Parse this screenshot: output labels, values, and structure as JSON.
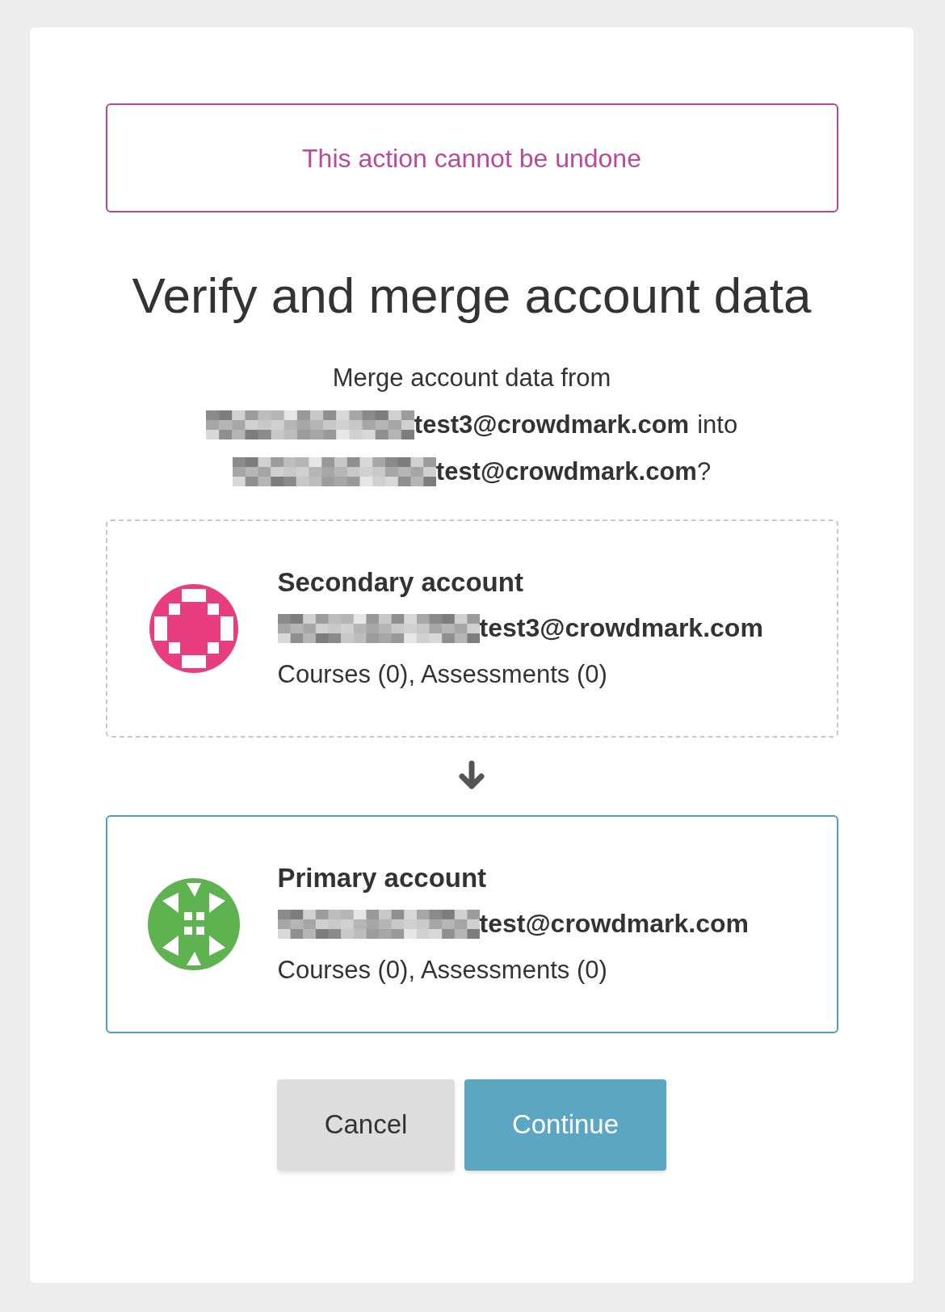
{
  "warning": "This action cannot be undone",
  "title": "Verify and merge account data",
  "message": {
    "intro": "Merge account data from",
    "from_email": "test3@crowdmark.com",
    "connector": "into",
    "to_email": "test@crowdmark.com",
    "end": "?"
  },
  "accounts": [
    {
      "kind": "secondary",
      "label": "Secondary account",
      "email": "test3@crowdmark.com",
      "summary": "Courses (0), Assessments (0)"
    },
    {
      "kind": "primary",
      "label": "Primary account",
      "email": "test@crowdmark.com",
      "summary": "Courses (0), Assessments (0)"
    }
  ],
  "buttons": [
    {
      "kind": "cancel",
      "label": "Cancel"
    },
    {
      "kind": "continue",
      "label": "Continue"
    }
  ]
}
